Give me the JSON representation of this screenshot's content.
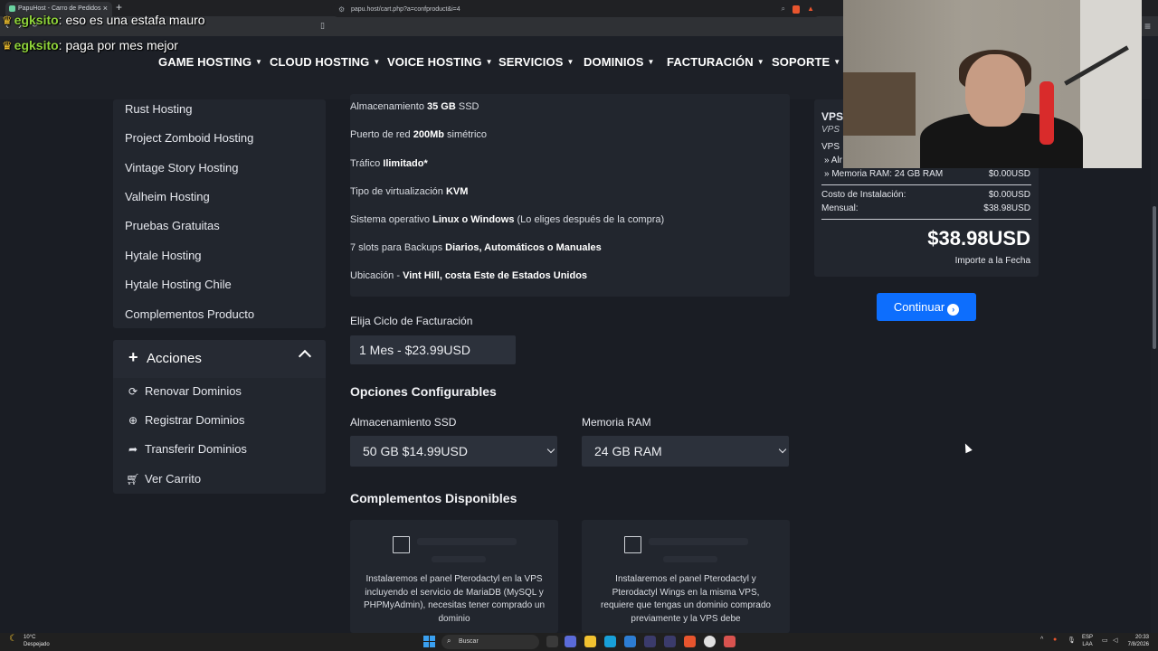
{
  "browser": {
    "tab_title": "PapuHost - Carro de Pedidos",
    "url": "papu.host/cart.php?a=confproduct&i=4"
  },
  "chat": [
    {
      "user": "egksito",
      "message": "eso es una estafa mauro"
    },
    {
      "user": "egksito",
      "message": "paga por mes mejor"
    }
  ],
  "nav": {
    "items": [
      "GAME HOSTING",
      "CLOUD HOSTING",
      "VOICE HOSTING",
      "SERVICIOS",
      "DOMINIOS",
      "FACTURACIÓN",
      "SOPORTE"
    ]
  },
  "sidebar": {
    "categories": [
      "Rust Hosting",
      "Project Zomboid Hosting",
      "Vintage Story Hosting",
      "Valheim Hosting",
      "Pruebas Gratuitas",
      "Hytale Hosting",
      "Hytale Hosting Chile",
      "Complementos Producto"
    ],
    "actions_title": "Acciones",
    "actions": [
      {
        "label": "Renovar Dominios",
        "icon": "refresh-icon"
      },
      {
        "label": "Registrar Dominios",
        "icon": "globe-icon"
      },
      {
        "label": "Transferir Dominios",
        "icon": "share-arrow-icon"
      },
      {
        "label": "Ver Carrito",
        "icon": "cart-icon"
      }
    ]
  },
  "specs": [
    {
      "pre": "Almacenamiento ",
      "bold": "35 GB",
      "post": " SSD"
    },
    {
      "pre": "Puerto de red ",
      "bold": "200Mb",
      "post": " simétrico"
    },
    {
      "pre": "Tráfico ",
      "bold": "Ilimitado*",
      "post": ""
    },
    {
      "pre": "Tipo de virtualización ",
      "bold": "KVM",
      "post": ""
    },
    {
      "pre": "Sistema operativo ",
      "bold": "Linux o Windows",
      "post": " (Lo eliges después de la compra)"
    },
    {
      "pre": "7 slots para Backups ",
      "bold": "Diarios, Automáticos o Manuales",
      "post": ""
    },
    {
      "pre": "Ubicación - ",
      "bold": "Vint Hill, costa Este de Estados Unidos",
      "post": ""
    }
  ],
  "billing": {
    "label": "Elija Ciclo de Facturación",
    "value": "1 Mes - $23.99USD"
  },
  "config": {
    "title": "Opciones Configurables",
    "storage_label": "Almacenamiento SSD",
    "storage_value": "50 GB $14.99USD",
    "ram_label": "Memoria RAM",
    "ram_value": "24 GB RAM"
  },
  "addons": {
    "title": "Complementos Disponibles",
    "items": [
      {
        "desc": "Instalaremos el panel Pterodactyl en la VPS incluyendo el servicio de MariaDB (MySQL y PHPMyAdmin), necesitas tener comprado un dominio"
      },
      {
        "desc": "Instalaremos el panel Pterodactyl y Pterodactyl Wings en la misma VPS, requiere que tengas un dominio comprado previamente y la VPS debe"
      }
    ]
  },
  "summary": {
    "title": "VPS",
    "subtitle": "VPS",
    "line1": "VPS",
    "line2": "» Alr",
    "ram_line": "» Memoria RAM: 24 GB RAM",
    "ram_price": "$0.00USD",
    "setup_label": "Costo de Instalación:",
    "setup_price": "$0.00USD",
    "monthly_label": "Mensual:",
    "monthly_price": "$38.98USD",
    "total": "$38.98USD",
    "total_sub": "Importe a la Fecha"
  },
  "continue_label": "Continuar",
  "taskbar": {
    "temp": "10°C",
    "weather": "Despejado",
    "search": "Buscar",
    "lang1": "ESP",
    "lang2": "LAA",
    "time": "20:33",
    "date": "7/8/2026"
  },
  "colors": {
    "accent": "#0d6efd",
    "card": "#22262e",
    "background": "#1a1d24"
  }
}
